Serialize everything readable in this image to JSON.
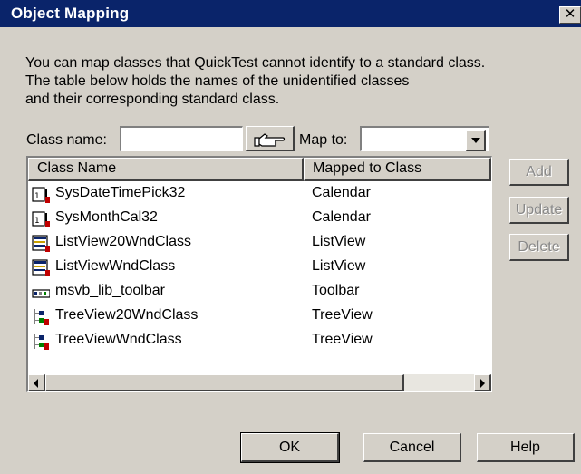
{
  "window": {
    "title": "Object Mapping",
    "close_glyph": "✕"
  },
  "description": {
    "line1": "You can map classes that QuickTest cannot identify to a standard class.",
    "line2": "The table below holds the names of the unidentified classes",
    "line3": "and their corresponding standard class."
  },
  "form": {
    "class_name_label": "Class name:",
    "class_name_value": "",
    "map_to_label": "Map to:",
    "map_to_value": ""
  },
  "table": {
    "headers": {
      "class_name": "Class Name",
      "mapped_to": "Mapped to Class"
    },
    "rows": [
      {
        "class_name": "SysDateTimePick32",
        "mapped_to": "Calendar",
        "icon": "calendar-icon"
      },
      {
        "class_name": "SysMonthCal32",
        "mapped_to": "Calendar",
        "icon": "calendar-icon"
      },
      {
        "class_name": "ListView20WndClass",
        "mapped_to": "ListView",
        "icon": "listview-icon"
      },
      {
        "class_name": "ListViewWndClass",
        "mapped_to": "ListView",
        "icon": "listview-icon"
      },
      {
        "class_name": "msvb_lib_toolbar",
        "mapped_to": "Toolbar",
        "icon": "toolbar-icon"
      },
      {
        "class_name": "TreeView20WndClass",
        "mapped_to": "TreeView",
        "icon": "treeview-icon"
      },
      {
        "class_name": "TreeViewWndClass",
        "mapped_to": "TreeView",
        "icon": "treeview-icon"
      }
    ]
  },
  "side_buttons": {
    "add": "Add",
    "update": "Update",
    "delete": "Delete"
  },
  "footer": {
    "ok": "OK",
    "cancel": "Cancel",
    "help": "Help"
  },
  "colors": {
    "title_bar": "#0a246a",
    "face": "#d4d0c8",
    "disabled_text": "#888888"
  }
}
